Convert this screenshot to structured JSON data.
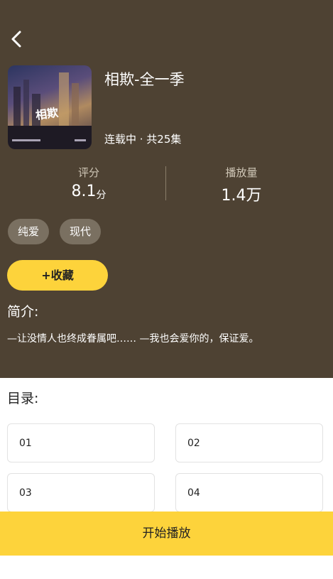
{
  "nav": {
    "back_icon": "chevron-left-icon"
  },
  "drama": {
    "title": "相欺-全一季",
    "status": "连载中 · 共25集"
  },
  "stats": {
    "rating_label": "评分",
    "rating_value": "8.1",
    "rating_unit": "分",
    "plays_label": "播放量",
    "plays_value": "1.4万"
  },
  "tags": [
    "纯爱",
    "现代"
  ],
  "actions": {
    "favorite_label": "+收藏",
    "play_label": "开始播放"
  },
  "intro": {
    "heading": "简介:",
    "text": "—让没情人也终成眷属吧…… —我也会爱你的，保证爱。"
  },
  "toc": {
    "heading": "目录:",
    "episodes": [
      "01",
      "02",
      "03",
      "04"
    ]
  },
  "colors": {
    "header_bg": "#4e4233",
    "accent": "#fdd33b"
  }
}
